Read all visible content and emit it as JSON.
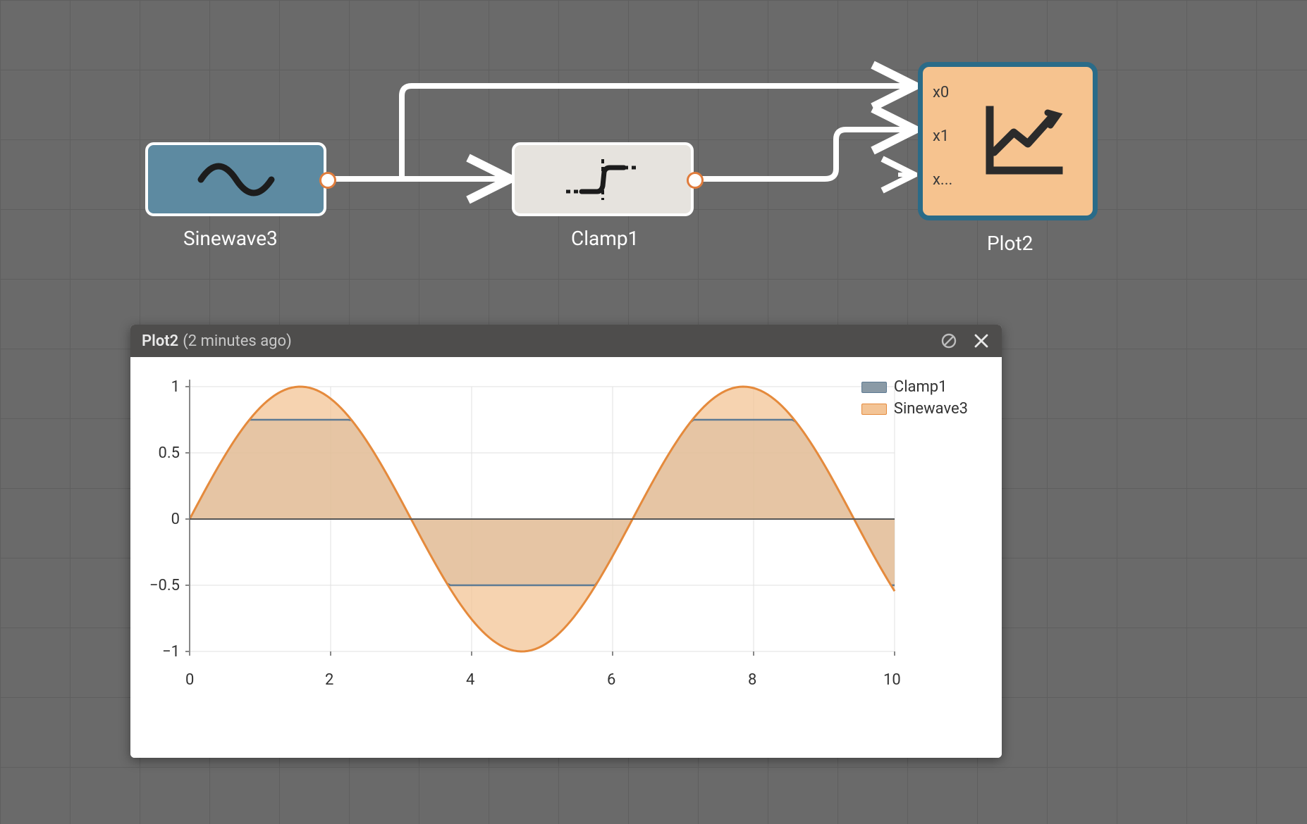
{
  "nodes": {
    "sinewave": {
      "label": "Sinewave3"
    },
    "clamp": {
      "label": "Clamp1"
    },
    "plot": {
      "label": "Plot2",
      "ports": [
        "x0",
        "x1",
        "x..."
      ]
    }
  },
  "panel": {
    "title": "Plot2",
    "timestamp": "(2 minutes ago)"
  },
  "legend": {
    "s0": "Clamp1",
    "s1": "Sinewave3"
  },
  "axes": {
    "y": {
      "m1": "1",
      "m05": "0.5",
      "m0": "0",
      "mn05": "−0.5",
      "mn1": "−1"
    },
    "x": {
      "t0": "0",
      "t2": "2",
      "t4": "4",
      "t6": "6",
      "t8": "8",
      "t10": "10"
    }
  },
  "colors": {
    "sine_fill": "#f3c496",
    "sine_stroke": "#e58a3c",
    "clamp_fill": "#8a9aa6",
    "clamp_stroke": "#5d7a93",
    "grid": "#e0e0e0",
    "axis": "#888"
  },
  "chart_data": {
    "type": "line",
    "title": "",
    "xlabel": "",
    "ylabel": "",
    "xlim": [
      0,
      10
    ],
    "ylim": [
      -1,
      1
    ],
    "x": [
      0,
      0.5,
      1,
      1.5,
      2,
      2.5,
      3,
      3.5,
      4,
      4.5,
      5,
      5.5,
      6,
      6.5,
      7,
      7.5,
      8,
      8.5,
      9,
      9.5,
      10
    ],
    "series": [
      {
        "name": "Sinewave3",
        "values": [
          0,
          0.48,
          0.84,
          1.0,
          0.91,
          0.6,
          0.14,
          -0.35,
          -0.76,
          -0.98,
          -0.96,
          -0.71,
          -0.28,
          0.22,
          0.66,
          0.94,
          1.0,
          0.8,
          0.41,
          -0.08,
          -0.54
        ]
      },
      {
        "name": "Clamp1",
        "values": [
          0,
          0.48,
          0.75,
          0.75,
          0.75,
          0.6,
          0.14,
          -0.35,
          -0.5,
          -0.5,
          -0.5,
          -0.5,
          -0.28,
          0.22,
          0.66,
          0.75,
          0.75,
          0.75,
          0.41,
          -0.08,
          -0.5
        ]
      }
    ],
    "clamp_bounds": {
      "upper": 0.75,
      "lower": -0.5
    },
    "legend_position": "top-right",
    "grid": true
  }
}
